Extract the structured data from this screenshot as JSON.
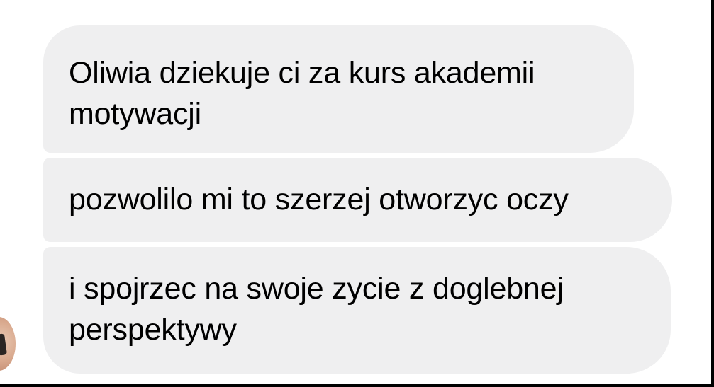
{
  "conversation": {
    "messages": [
      {
        "text": "Oliwia dziekuje ci za kurs akademii motywacji"
      },
      {
        "text": "pozwolilo mi to szerzej otworzyc oczy"
      },
      {
        "text": "i spojrzec na swoje zycie z doglebnej perspektywy"
      }
    ]
  },
  "colors": {
    "bubble_background": "#efeff0",
    "text": "#000000",
    "page_background": "#ffffff"
  },
  "icons": {
    "sender_avatar": "avatar-photo"
  }
}
